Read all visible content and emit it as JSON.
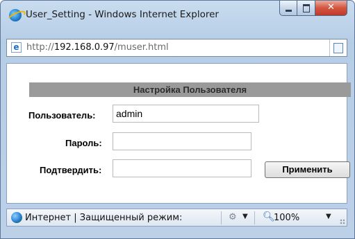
{
  "window": {
    "title": "User_Setting - Windows Internet Explorer"
  },
  "address": {
    "prefix": "http://",
    "host": "192.168.0.97",
    "path": "/muser.html"
  },
  "form": {
    "heading": "Настройка Пользователя",
    "user_label": "Пользователь:",
    "user_value": "admin",
    "password_label": "Пароль:",
    "password_value": "",
    "confirm_label": "Подтвердить:",
    "confirm_value": "",
    "apply_label": "Применить"
  },
  "status": {
    "zone_text": "Интернет | Защищенный режим:",
    "zoom": "100%"
  },
  "icons": {
    "title": "ie-icon",
    "address": "page-icon",
    "status": "globe-icon",
    "zoom": "magnifier-icon"
  }
}
